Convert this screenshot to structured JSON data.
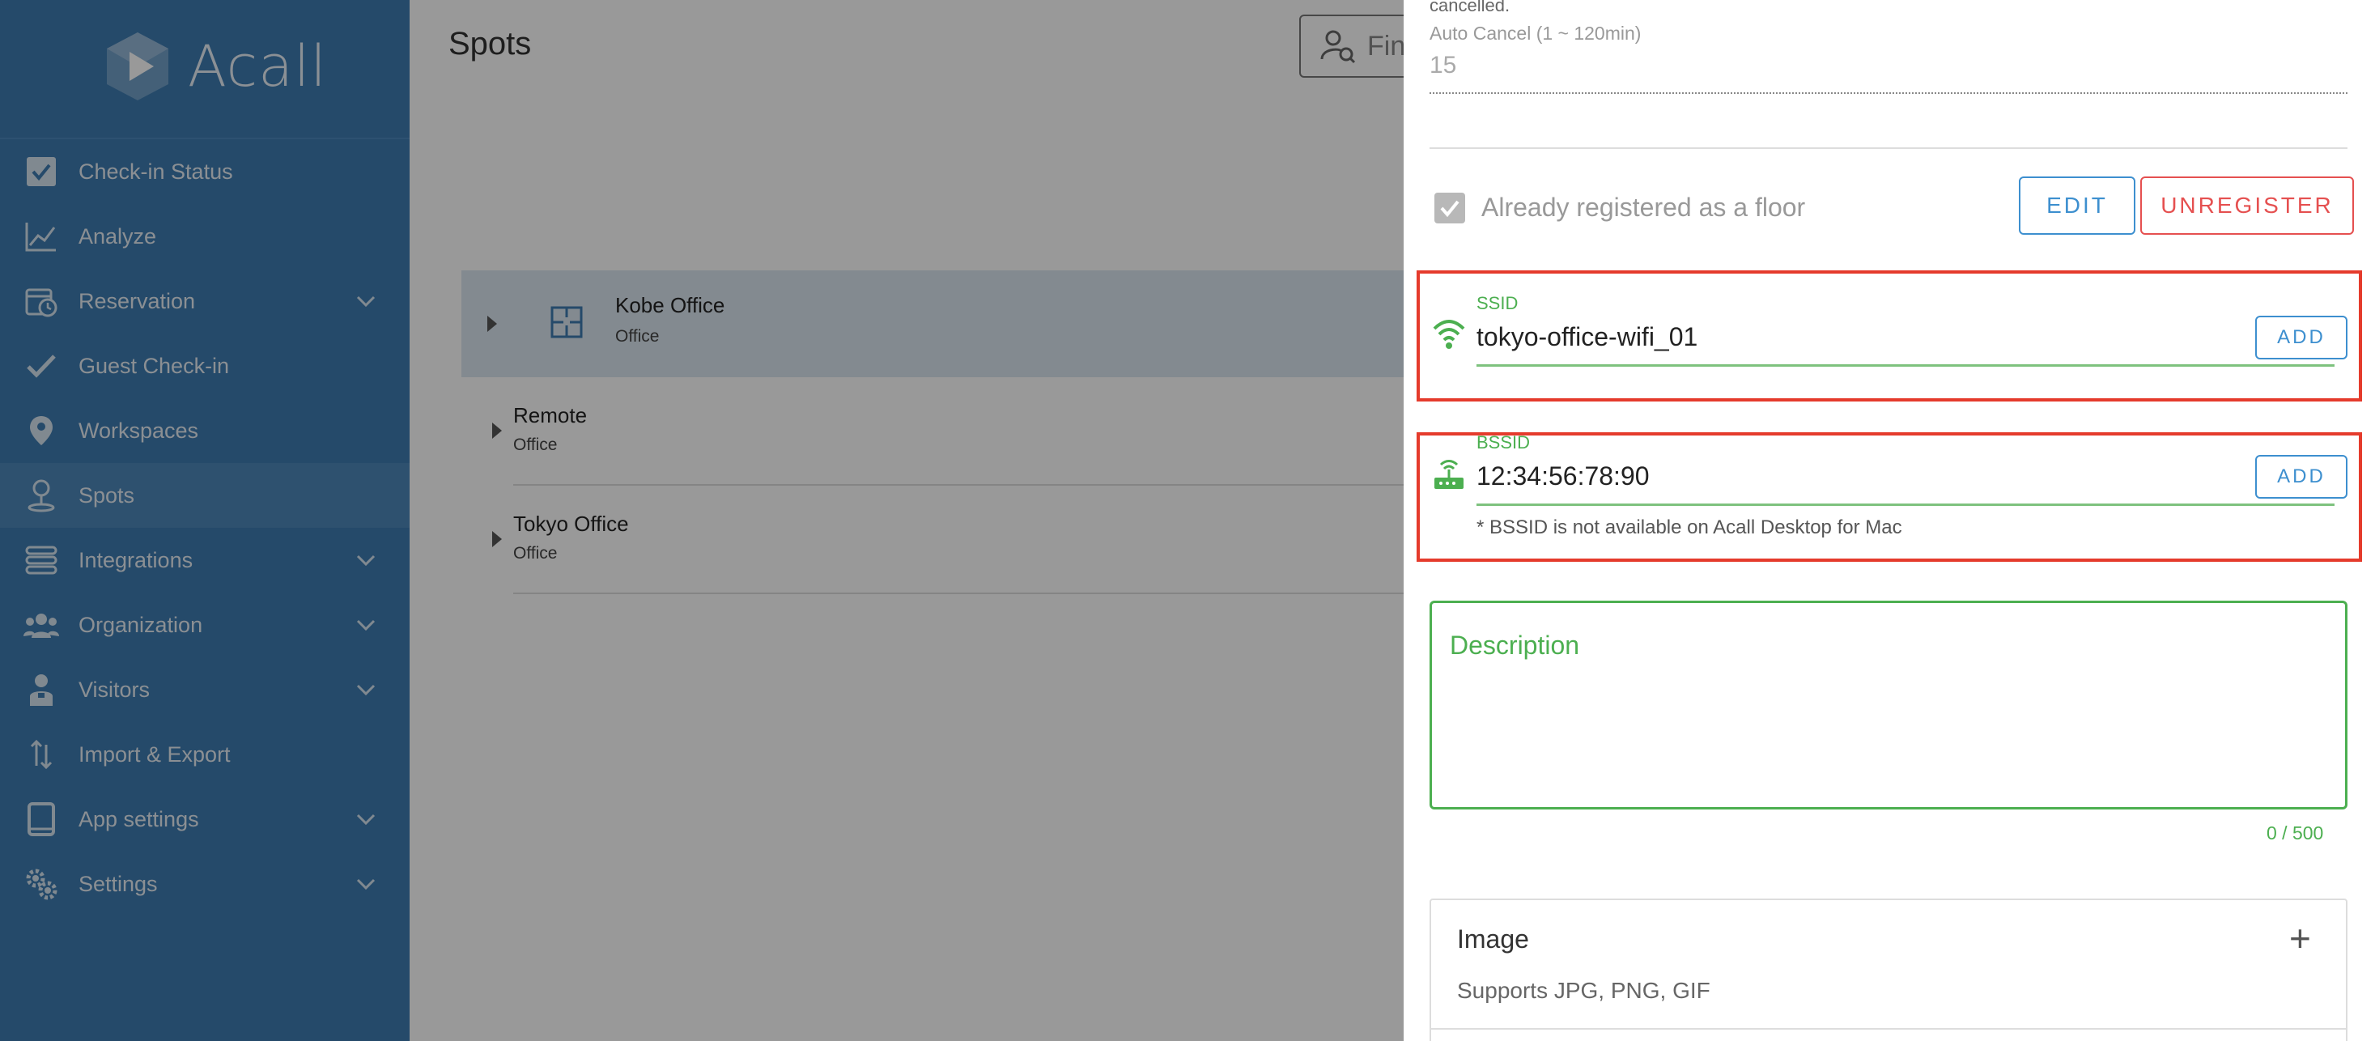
{
  "app": {
    "name": "Acall"
  },
  "sidebar": {
    "items": [
      {
        "label": "Check-in Status",
        "icon": "checkbox-icon",
        "expandable": false
      },
      {
        "label": "Analyze",
        "icon": "chart-line-icon",
        "expandable": false
      },
      {
        "label": "Reservation",
        "icon": "calendar-clock-icon",
        "expandable": true
      },
      {
        "label": "Guest Check-in",
        "icon": "checkmark-icon",
        "expandable": false
      },
      {
        "label": "Workspaces",
        "icon": "map-pin-icon",
        "expandable": false
      },
      {
        "label": "Spots",
        "icon": "location-person-icon",
        "expandable": false,
        "active": true
      },
      {
        "label": "Integrations",
        "icon": "integrations-icon",
        "expandable": true
      },
      {
        "label": "Organization",
        "icon": "people-group-icon",
        "expandable": true
      },
      {
        "label": "Visitors",
        "icon": "visitor-icon",
        "expandable": true
      },
      {
        "label": "Import & Export",
        "icon": "import-export-icon",
        "expandable": false
      },
      {
        "label": "App settings",
        "icon": "tablet-icon",
        "expandable": true
      },
      {
        "label": "Settings",
        "icon": "gears-icon",
        "expandable": true
      }
    ]
  },
  "main": {
    "title": "Spots",
    "search_placeholder": "Fin",
    "spots": [
      {
        "name": "Kobe Office",
        "type": "Office"
      },
      {
        "name": "Remote",
        "type": "Office"
      },
      {
        "name": "Tokyo Office",
        "type": "Office"
      }
    ]
  },
  "panel": {
    "cancel_note": "cancelled.",
    "auto_cancel_label": "Auto Cancel (1 ~ 120min)",
    "auto_cancel_value": "15",
    "registered_label": "Already registered as a floor",
    "edit_label": "EDIT",
    "unregister_label": "UNREGISTER",
    "ssid": {
      "label": "SSID",
      "value": "tokyo-office-wifi_01",
      "add_label": "ADD"
    },
    "bssid": {
      "label": "BSSID",
      "value": "12:34:56:78:90",
      "add_label": "ADD",
      "note": "* BSSID is not available on Acall Desktop for Mac"
    },
    "description": {
      "label": "Description",
      "count": "0 / 500"
    },
    "image": {
      "title": "Image",
      "subtitle": "Supports JPG, PNG, GIF"
    }
  },
  "colors": {
    "sidebar_bg": "#3e7cb1",
    "accent_blue": "#3d8fcf",
    "danger_red": "#e55050",
    "highlight_red": "#e53b2c",
    "success_green": "#4caf50"
  }
}
